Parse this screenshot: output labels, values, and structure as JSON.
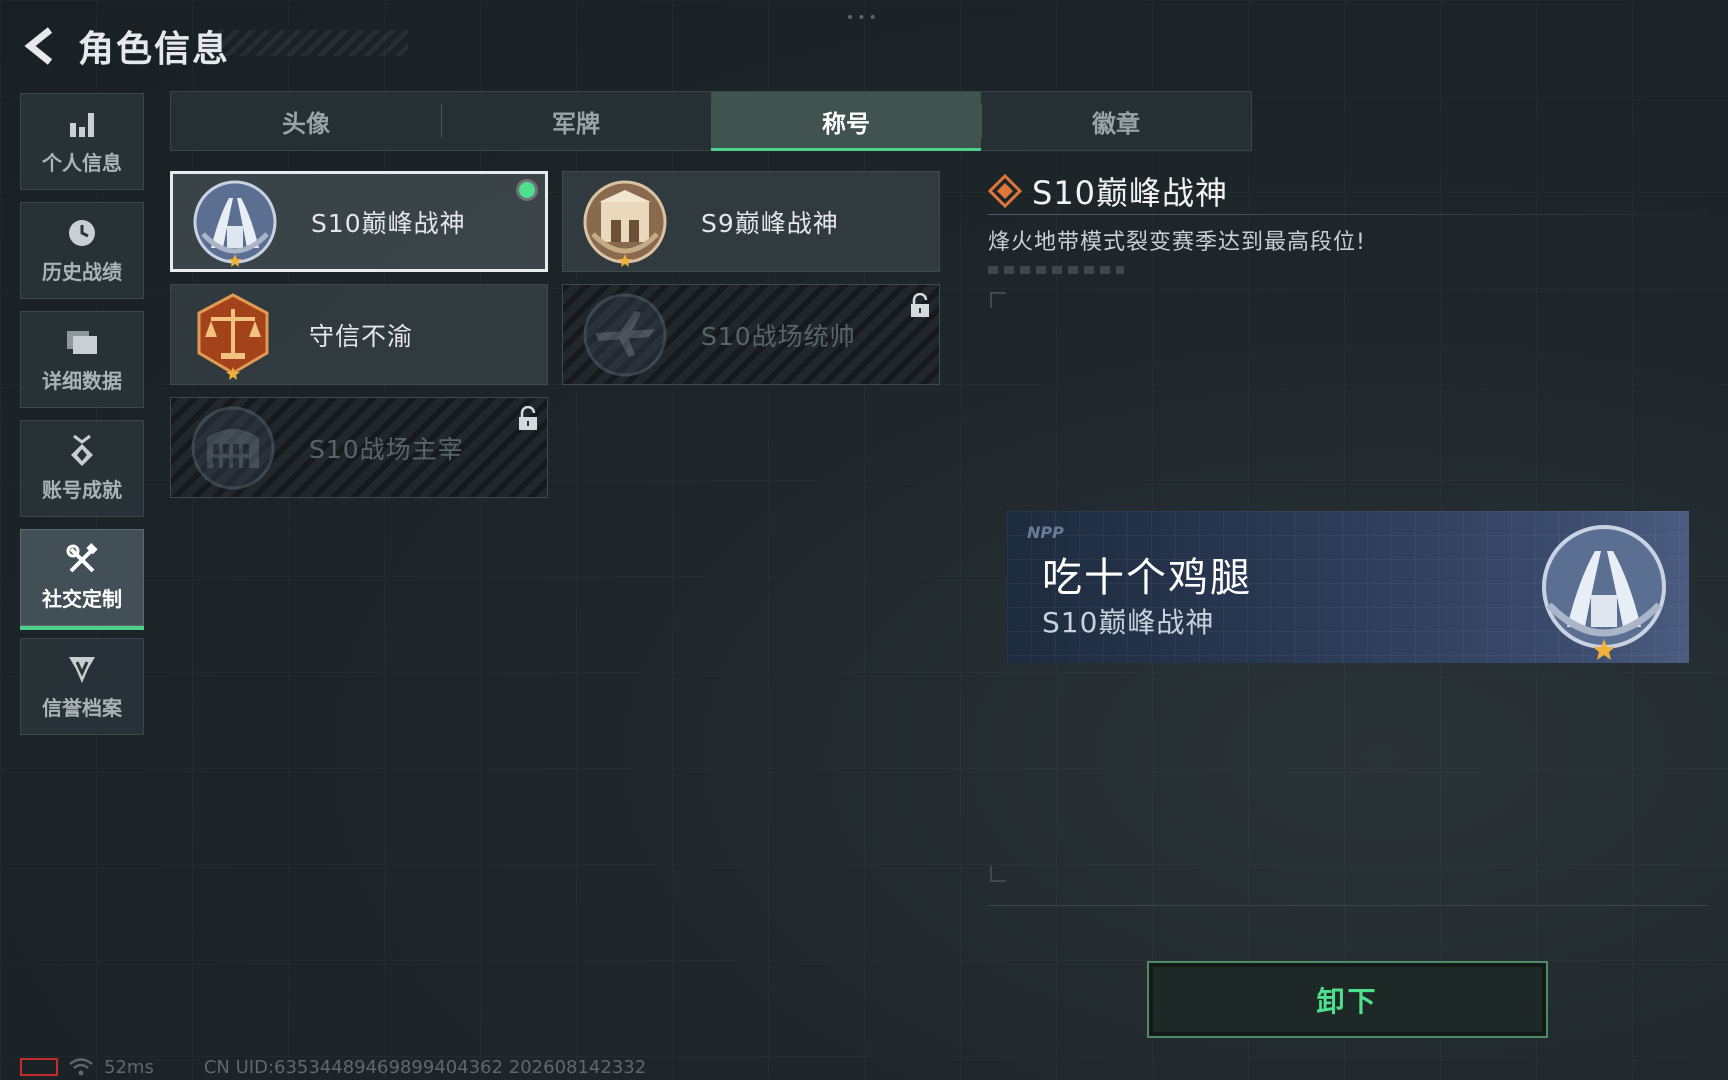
{
  "header": {
    "title": "角色信息"
  },
  "sidebar": {
    "items": [
      {
        "label": "个人信息",
        "icon": "bar-chart-icon",
        "active": false
      },
      {
        "label": "历史战绩",
        "icon": "clock-icon",
        "active": false
      },
      {
        "label": "详细数据",
        "icon": "folder-icon",
        "active": false
      },
      {
        "label": "账号成就",
        "icon": "medal-icon",
        "active": false
      },
      {
        "label": "社交定制",
        "icon": "tools-icon",
        "active": true
      },
      {
        "label": "信誉档案",
        "icon": "shield-icon",
        "active": false
      }
    ]
  },
  "tabs": [
    {
      "label": "头像",
      "active": false
    },
    {
      "label": "军牌",
      "active": false
    },
    {
      "label": "称号",
      "active": true
    },
    {
      "label": "徽章",
      "active": false
    }
  ],
  "titles": [
    {
      "name": "S10巅峰战神",
      "emblem": "peak-tower-emblem",
      "selected": true,
      "equipped": true,
      "locked": false
    },
    {
      "name": "S9巅峰战神",
      "emblem": "peak-gate-emblem",
      "selected": false,
      "equipped": false,
      "locked": false
    },
    {
      "name": "守信不渝",
      "emblem": "scales-of-justice-emblem",
      "selected": false,
      "equipped": false,
      "locked": false
    },
    {
      "name": "S10战场统帅",
      "emblem": "aircraft-emblem",
      "selected": false,
      "equipped": false,
      "locked": true
    },
    {
      "name": "S10战场主宰",
      "emblem": "colosseum-emblem",
      "selected": false,
      "equipped": false,
      "locked": true
    }
  ],
  "detail": {
    "title": "S10巅峰战神",
    "description": "烽火地带模式裂变赛季达到最高段位!"
  },
  "preview": {
    "logo": "NPP",
    "player_name": "吃十个鸡腿",
    "title": "S10巅峰战神"
  },
  "actions": {
    "unequip_label": "卸下"
  },
  "status": {
    "ping": "52ms",
    "uid": "CN UID:63534489469899404362 202608142332"
  },
  "colors": {
    "accent_green": "#4fd08a",
    "battery_red": "#c42b2b",
    "preview_blue": "#2b3a55"
  }
}
